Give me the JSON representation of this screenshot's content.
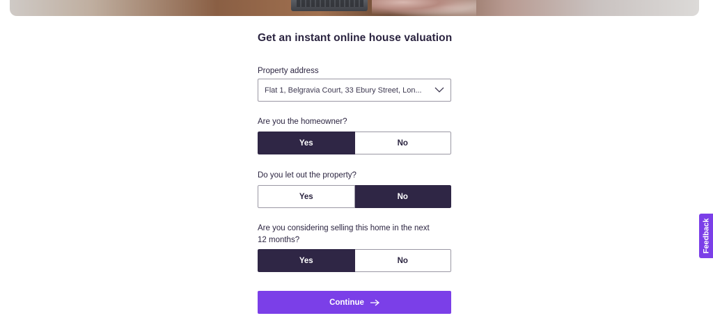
{
  "page": {
    "title": "Get an instant online house valuation"
  },
  "address": {
    "label": "Property address",
    "value": "Flat 1, Belgravia Court, 33 Ebury Street, Lon...",
    "icon": "chevron-down-icon"
  },
  "homeowner": {
    "label": "Are you the homeowner?",
    "options": [
      "Yes",
      "No"
    ],
    "selected": "Yes"
  },
  "let_out": {
    "label": "Do you let out the property?",
    "options": [
      "Yes",
      "No"
    ],
    "selected": "No"
  },
  "selling": {
    "label_line1": "Are you considering selling this home in the next",
    "label_line2": "12 months?",
    "options": [
      "Yes",
      "No"
    ],
    "selected": "Yes"
  },
  "continue_button": {
    "label": "Continue",
    "icon": "arrow-right-icon"
  },
  "feedback_tab": {
    "label": "Feedback"
  },
  "colors": {
    "accent": "#7b3fe8",
    "selected": "#2f2645",
    "text": "#2b2440"
  }
}
